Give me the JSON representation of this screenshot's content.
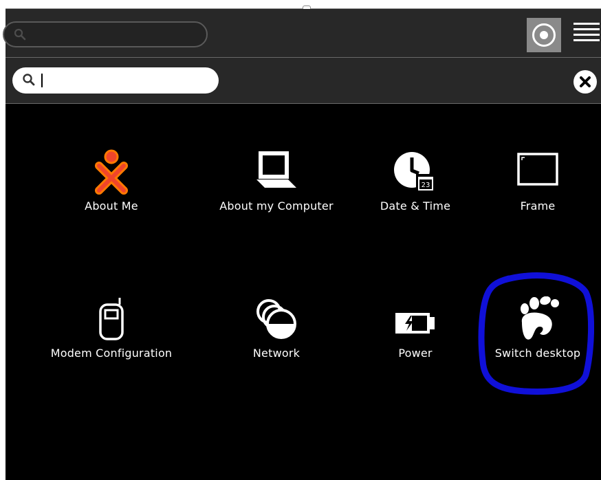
{
  "toolbar": {
    "search_placeholder": "",
    "view_mode_icon": "home-view-icon",
    "list_icon": "list-view-icon"
  },
  "control_panel": {
    "search_value": "",
    "close_icon": "close-icon"
  },
  "items": [
    {
      "label": "About Me",
      "icon": "xo-person-icon"
    },
    {
      "label": "About my Computer",
      "icon": "laptop-icon"
    },
    {
      "label": "Date & Time",
      "icon": "clock-calendar-icon",
      "badge": "23"
    },
    {
      "label": "Frame",
      "icon": "frame-icon"
    },
    {
      "label": "Modem Configuration",
      "icon": "phone-icon"
    },
    {
      "label": "Network",
      "icon": "network-icon"
    },
    {
      "label": "Power",
      "icon": "battery-icon"
    },
    {
      "label": "Switch desktop",
      "icon": "gnome-foot-icon"
    }
  ],
  "colors": {
    "background": "#000000",
    "toolbar": "#282828",
    "xo_stroke": "#ff7a00",
    "xo_fill": "#f0452b",
    "highlight": "#1010d8"
  }
}
